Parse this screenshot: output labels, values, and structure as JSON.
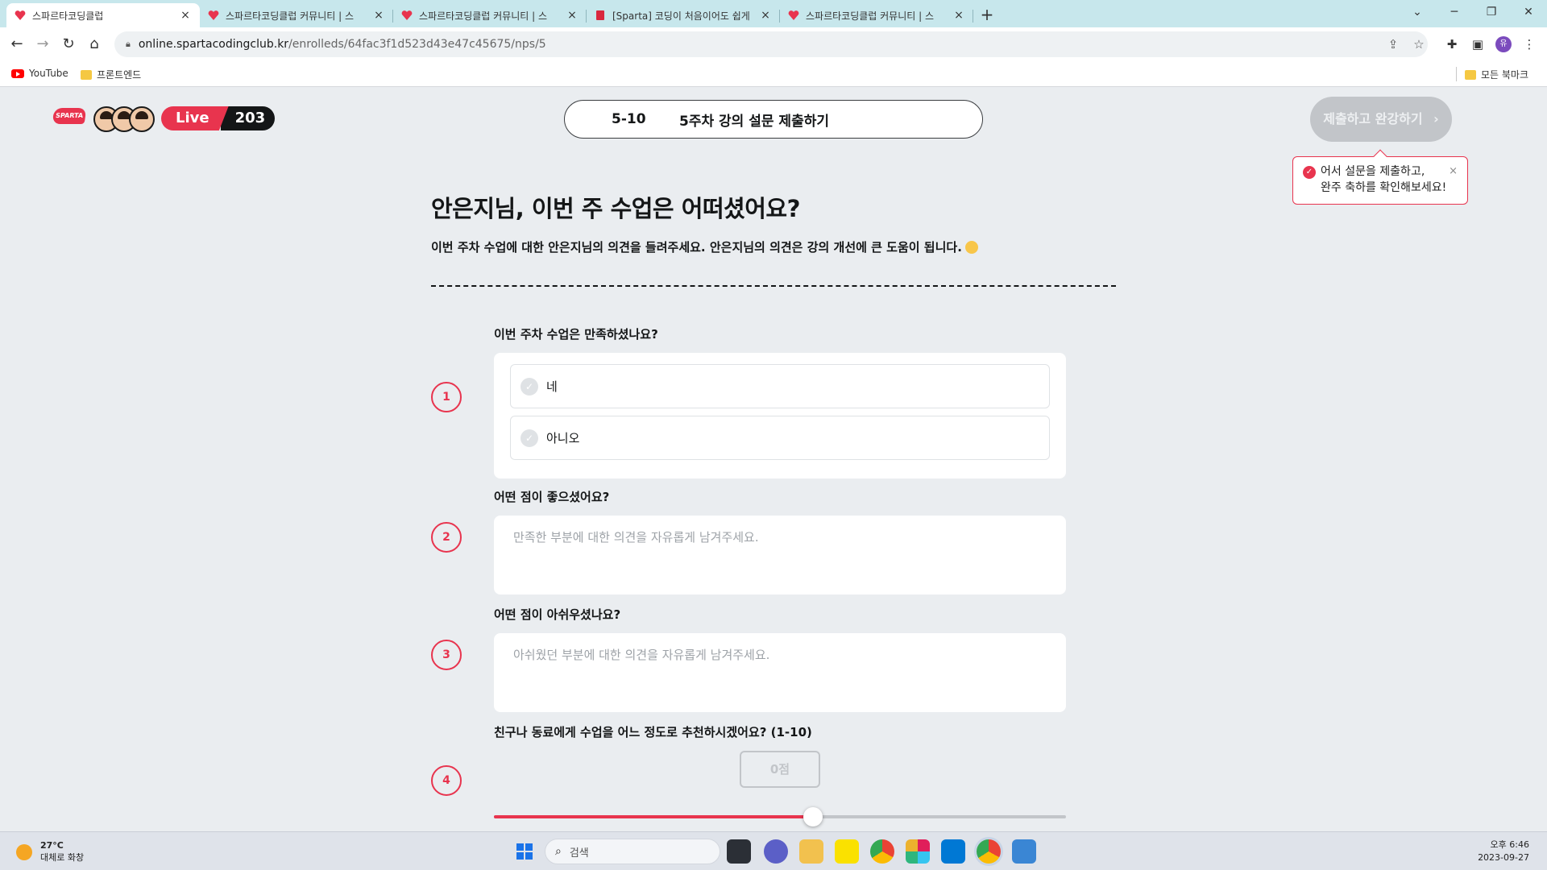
{
  "browser": {
    "tabs": [
      {
        "title": "스파르타코딩클럽",
        "active": true
      },
      {
        "title": "스파르타코딩클럽 커뮤니티 | 스",
        "active": false
      },
      {
        "title": "스파르타코딩클럽 커뮤니티 | 스",
        "active": false
      },
      {
        "title": "[Sparta] 코딩이 처음이어도 쉽게",
        "active": false
      },
      {
        "title": "스파르타코딩클럽 커뮤니티 | 스",
        "active": false
      }
    ],
    "tab_close": "×",
    "new_tab": "+",
    "url_host": "online.spartacodingclub.kr",
    "url_path": "/enrolleds/64fac3f1d523d43e47c45675/nps/5",
    "profile_initial": "유",
    "bookmarks": [
      {
        "label": "YouTube",
        "icon": "youtube-icon"
      },
      {
        "label": "프론트엔드",
        "icon": "folder-icon"
      }
    ],
    "all_bookmarks": "모든 북마크"
  },
  "header": {
    "logo_text": "SPARTA",
    "live_label": "Live",
    "live_count": "203",
    "lesson_number": "5-10",
    "lesson_title": "5주차 강의 설문 제출하기",
    "submit_label": "제출하고 완강하기",
    "tooltip_line1": "어서 설문을 제출하고,",
    "tooltip_line2": "완주 축하를 확인해보세요!",
    "tooltip_close": "×"
  },
  "survey": {
    "headline": "안은지님, 이번 주 수업은 어떠셨어요?",
    "subtext": "이번 주차 수업에 대한 안은지님의 의견을 들려주세요. 안은지님의 의견은 강의 개선에 큰 도움이 됩니다.",
    "questions": [
      {
        "number": "1",
        "label": "이번 주차 수업은 만족하셨나요?",
        "options": [
          "네",
          "아니오"
        ]
      },
      {
        "number": "2",
        "label": "어떤 점이 좋으셨어요?",
        "placeholder": "만족한 부분에 대한 의견을 자유롭게 남겨주세요."
      },
      {
        "number": "3",
        "label": "어떤 점이 아쉬우셨나요?",
        "placeholder": "아쉬웠던 부분에 대한 의견을 자유롭게 남겨주세요."
      },
      {
        "number": "4",
        "label": "친구나 동료에게 수업을 어느 정도로 추천하시겠어요? (1-10)",
        "score_label": "0점",
        "slider_percent": 55.8
      }
    ]
  },
  "taskbar": {
    "temperature": "27°C",
    "weather_desc": "대체로 화창",
    "search_placeholder": "검색",
    "time": "오후 6:46",
    "date": "2023-09-27"
  },
  "colors": {
    "accent": "#e8344e",
    "page_bg": "#eaedf0",
    "tab_strip": "#c7e7ec"
  }
}
